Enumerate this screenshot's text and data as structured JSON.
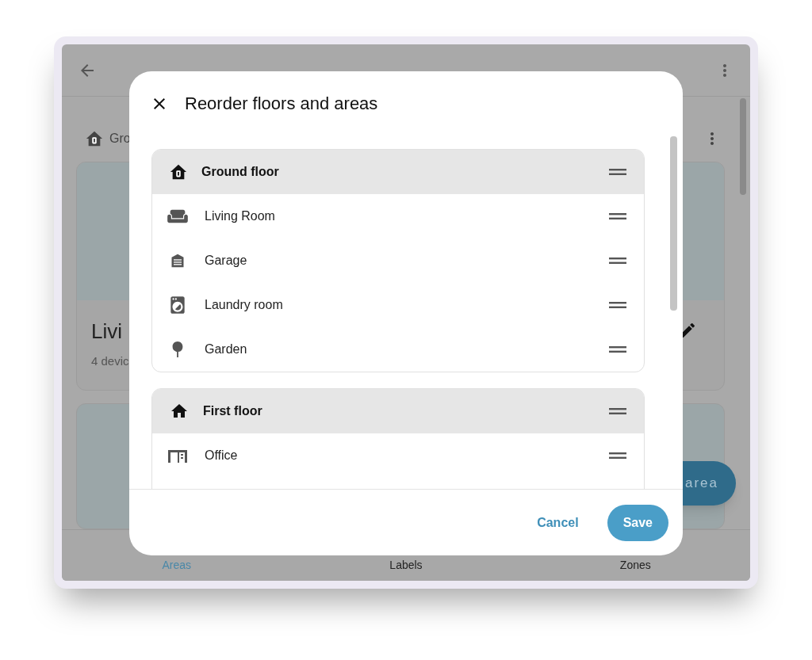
{
  "background": {
    "floor_header": {
      "label": "Gro"
    },
    "area_card": {
      "name": "Livi",
      "subtitle": "4 devic"
    },
    "fab": {
      "label": "area"
    },
    "bottom_nav": [
      {
        "label": "Areas",
        "selected": true
      },
      {
        "label": "Labels",
        "selected": false
      },
      {
        "label": "Zones",
        "selected": false
      }
    ]
  },
  "dialog": {
    "title": "Reorder floors and areas",
    "floors": [
      {
        "name": "Ground floor",
        "areas": [
          {
            "name": "Living Room"
          },
          {
            "name": "Garage"
          },
          {
            "name": "Laundry room"
          },
          {
            "name": "Garden"
          }
        ]
      },
      {
        "name": "First floor",
        "areas": [
          {
            "name": "Office"
          }
        ]
      }
    ],
    "buttons": [
      {
        "label": "Cancel",
        "kind": "text"
      },
      {
        "label": "Save",
        "kind": "filled"
      }
    ]
  }
}
